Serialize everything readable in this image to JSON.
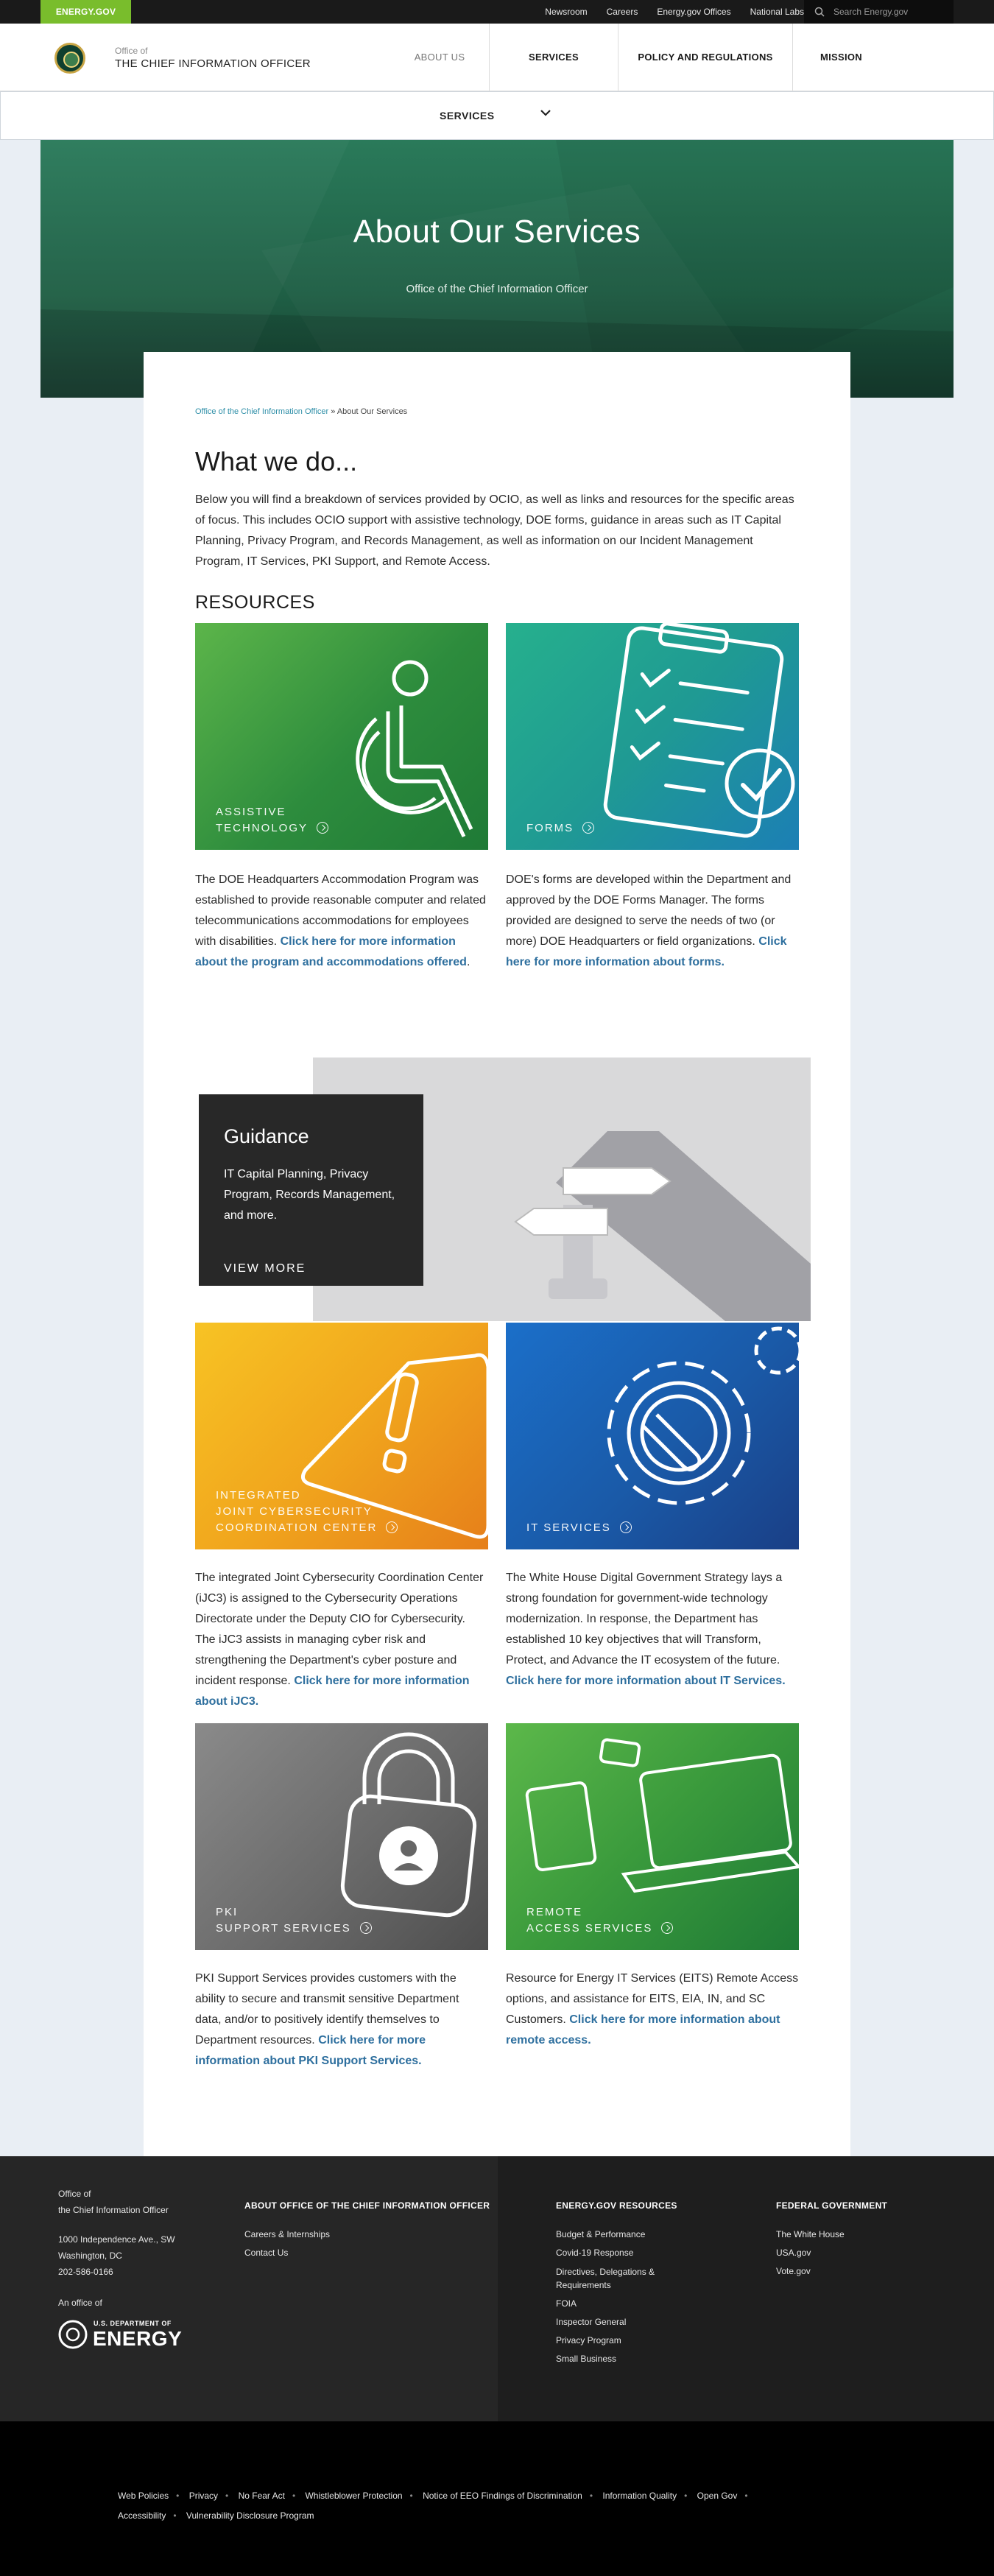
{
  "utility": {
    "badge": "ENERGY.GOV",
    "links": [
      "Newsroom",
      "Careers",
      "Energy.gov Offices",
      "National Labs"
    ],
    "search_placeholder": "Search Energy.gov"
  },
  "header": {
    "office_small": "Office of",
    "office_title": "THE CHIEF INFORMATION OFFICER",
    "nav": [
      "ABOUT US",
      "SERVICES",
      "POLICY AND REGULATIONS",
      "MISSION"
    ]
  },
  "services_bar": {
    "label": "SERVICES"
  },
  "hero": {
    "title": "About Our Services",
    "subtitle": "Office of the Chief Information Officer"
  },
  "breadcrumb": {
    "parent": "Office of the Chief Information Officer",
    "separator": " » ",
    "current": "About Our Services"
  },
  "main": {
    "heading": "What we do...",
    "intro": "Below you will find a breakdown of services provided by OCIO, as well as links and resources for the specific areas of focus. This includes OCIO support with assistive technology, DOE forms, guidance in areas such as IT Capital Planning, Privacy Program, and Records Management, as well as information on our Incident Management Program, IT Services, PKI Support, and Remote Access.",
    "resources_heading": "RESOURCES"
  },
  "tiles": {
    "assistive": {
      "label_l1": "ASSISTIVE",
      "label_l2": "TECHNOLOGY",
      "text": "The DOE Headquarters Accommodation Program was established to provide reasonable computer and related telecommunications accommodations for employees with disabilities. ",
      "link": "Click here for more information about the program and accommodations offered",
      "after": ".",
      "color": "#2f8a3c"
    },
    "forms": {
      "label_l1": "FORMS",
      "text": "DOE's forms are developed within the Department and approved by the DOE Forms Manager. The forms provided are designed to serve the needs of two (or more) DOE Headquarters or field organizations. ",
      "link": "Click here for more information about forms.",
      "color": "#1f9a8a"
    },
    "ijc3": {
      "label_l1": "INTEGRATED",
      "label_l2": "JOINT CYBERSECURITY",
      "label_l3": "COORDINATION CENTER",
      "text": "The integrated Joint Cybersecurity Coordination Center (iJC3) is assigned to the Cybersecurity Operations Directorate under the Deputy CIO for Cybersecurity.  The iJC3 assists in managing cyber risk and strengthening the Department's cyber posture and incident response. ",
      "link": "Click here for more information about iJC3.",
      "color": "#f0a31c"
    },
    "it": {
      "label_l1": "IT SERVICES",
      "text": "The White House Digital Government Strategy lays a strong foundation for government-wide technology modernization. In response, the Department has established 10 key objectives that will Transform, Protect, and Advance the IT ecosystem of the future. ",
      "link": "Click here for more information about IT Services.",
      "color": "#1a5fb0"
    },
    "pki": {
      "label_l1": "PKI",
      "label_l2": "SUPPORT SERVICES",
      "text": "PKI Support Services provides customers with the ability to secure and transmit sensitive Department data, and/or to positively identify themselves to Department resources. ",
      "link": "Click here for more information about PKI Support Services.",
      "color": "#6a6a6a"
    },
    "remote": {
      "label_l1": "REMOTE",
      "label_l2": "ACCESS SERVICES",
      "text": "Resource for Energy IT Services (EITS) Remote Access options, and assistance for EITS, EIA, IN, and SC Customers. ",
      "link": "Click here for more information about remote access.",
      "color": "#3a9a3c"
    }
  },
  "guidance": {
    "title": "Guidance",
    "text": "IT Capital Planning, Privacy Program, Records Management, and more.",
    "cta": "VIEW MORE"
  },
  "footer": {
    "office_l1": "Office of",
    "office_l2": "the Chief Information Officer",
    "address_l1": "1000 Independence Ave., SW",
    "address_l2": "Washington, DC",
    "phone": "202-586-0166",
    "office_of": "An office of",
    "doe_small": "U.S. DEPARTMENT OF",
    "doe_big": "ENERGY",
    "col1_heading": "ABOUT OFFICE OF THE CHIEF INFORMATION OFFICER",
    "col1_links": [
      "Careers & Internships",
      "Contact Us"
    ],
    "col2_heading": "ENERGY.GOV RESOURCES",
    "col2_links": [
      "Budget & Performance",
      "Covid-19 Response",
      "Directives, Delegations &",
      "Requirements",
      "FOIA",
      "Inspector General",
      "Privacy Program",
      "Small Business"
    ],
    "col3_heading": "FEDERAL GOVERNMENT",
    "col3_links": [
      "The White House",
      "USA.gov",
      "Vote.gov"
    ],
    "bottom_links": [
      "Web Policies",
      "Privacy",
      "No Fear Act",
      "Whistleblower Protection",
      "Notice of EEO Findings of Discrimination",
      "Information Quality",
      "Open Gov",
      "Accessibility",
      "Vulnerability Disclosure Program"
    ]
  }
}
